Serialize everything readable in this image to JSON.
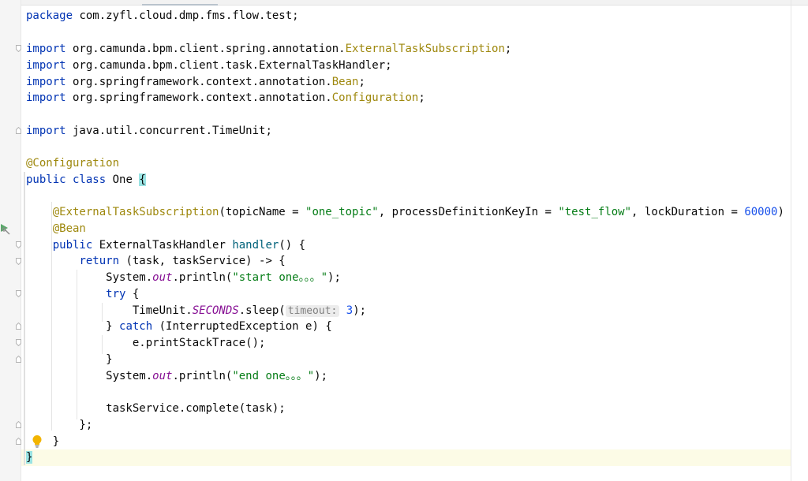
{
  "editor": {
    "language": "Java",
    "lines": {
      "l1": {
        "t1": "package",
        "t2": " com.zyfl.cloud.dmp.fms.flow.test;"
      },
      "l3": {
        "t1": "import",
        "t2": " org.camunda.bpm.client.spring.annotation.",
        "t3": "ExternalTaskSubscription",
        "t4": ";"
      },
      "l4": {
        "t1": "import",
        "t2": " org.camunda.bpm.client.task.ExternalTaskHandler;"
      },
      "l5": {
        "t1": "import",
        "t2": " org.springframework.context.annotation.",
        "t3": "Bean",
        "t4": ";"
      },
      "l6": {
        "t1": "import",
        "t2": " org.springframework.context.annotation.",
        "t3": "Configuration",
        "t4": ";"
      },
      "l8": {
        "t1": "import",
        "t2": " java.util.concurrent.TimeUnit;"
      },
      "l10": {
        "t1": "@Configuration"
      },
      "l11": {
        "t1": "public class",
        "t2": " One ",
        "t3": "{"
      },
      "l13": {
        "t1": "    ",
        "t2": "@ExternalTaskSubscription",
        "t3": "(topicName = ",
        "t4": "\"one_topic\"",
        "t5": ", processDefinitionKeyIn = ",
        "t6": "\"test_flow\"",
        "t7": ", lockDuration = ",
        "t8": "60000",
        "t9": ")"
      },
      "l14": {
        "t1": "    ",
        "t2": "@Bean"
      },
      "l15": {
        "t1": "    ",
        "t2": "public",
        "t3": " ExternalTaskHandler ",
        "t4": "handler",
        "t5": "() {"
      },
      "l16": {
        "t1": "        ",
        "t2": "return",
        "t3": " (task, taskService) -> {"
      },
      "l17": {
        "t1": "            System.",
        "t2": "out",
        "t3": ".println(",
        "t4": "\"start one。。。\"",
        "t5": ");"
      },
      "l18": {
        "t1": "            ",
        "t2": "try",
        "t3": " {"
      },
      "l19": {
        "t1": "                TimeUnit.",
        "t2": "SECONDS",
        "t3": ".sleep(",
        "t4": "timeout:",
        "t5": " 3",
        "t6": ");"
      },
      "l20": {
        "t1": "            } ",
        "t2": "catch",
        "t3": " (InterruptedException e) {"
      },
      "l21": {
        "t1": "                e.printStackTrace();"
      },
      "l22": {
        "t1": "            }"
      },
      "l23": {
        "t1": "            System.",
        "t2": "out",
        "t3": ".println(",
        "t4": "\"end one。。。\"",
        "t5": ");"
      },
      "l25": {
        "t1": "            taskService.complete(task);"
      },
      "l26": {
        "t1": "        };"
      },
      "l27": {
        "t1": "    }"
      },
      "l28": {
        "t1": "}"
      }
    }
  },
  "gutter": {
    "run_icon": "run-marker-icon",
    "intention_icon": "lightbulb-icon"
  },
  "colors": {
    "keyword": "#0033b3",
    "annotation": "#9e880d",
    "string": "#067d17",
    "number": "#1750eb",
    "static_field": "#871094",
    "method_declaration": "#00627a",
    "caret_line": "#fcfbe6",
    "brace_match": "#99e3e3"
  }
}
